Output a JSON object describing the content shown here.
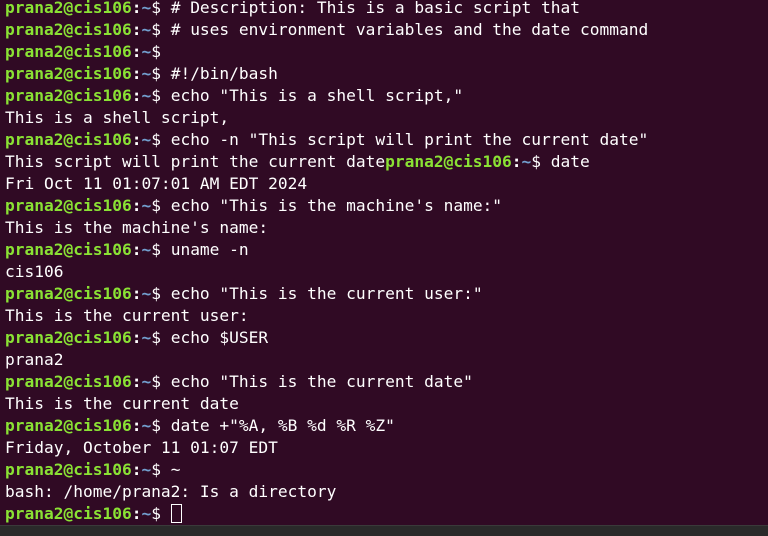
{
  "terminal": {
    "colors": {
      "background": "#300a24",
      "text": "#ffffff",
      "prompt_user": "#8ae234",
      "prompt_path": "#729fcf"
    },
    "prompt": {
      "user_host": "prana2@cis106",
      "colon": ":",
      "path": "~",
      "symbol": "$"
    },
    "lines": [
      {
        "type": "prompt",
        "cmd": " # Description: This is a basic script that"
      },
      {
        "type": "prompt",
        "cmd": " # uses environment variables and the date command"
      },
      {
        "type": "prompt",
        "cmd": ""
      },
      {
        "type": "prompt",
        "cmd": " #!/bin/bash"
      },
      {
        "type": "prompt",
        "cmd": " echo \"This is a shell script,\""
      },
      {
        "type": "output",
        "text": "This is a shell script,"
      },
      {
        "type": "prompt",
        "cmd": " echo -n \"This script will print the current date\""
      },
      {
        "type": "mixed",
        "text": "This script will print the current date",
        "cmd": " date"
      },
      {
        "type": "output",
        "text": "Fri Oct 11 01:07:01 AM EDT 2024"
      },
      {
        "type": "prompt",
        "cmd": " echo \"This is the machine's name:\""
      },
      {
        "type": "output",
        "text": "This is the machine's name:"
      },
      {
        "type": "prompt",
        "cmd": " uname -n"
      },
      {
        "type": "output",
        "text": "cis106"
      },
      {
        "type": "prompt",
        "cmd": " echo \"This is the current user:\""
      },
      {
        "type": "output",
        "text": "This is the current user:"
      },
      {
        "type": "prompt",
        "cmd": " echo $USER"
      },
      {
        "type": "output",
        "text": "prana2"
      },
      {
        "type": "prompt",
        "cmd": " echo \"This is the current date\""
      },
      {
        "type": "output",
        "text": "This is the current date"
      },
      {
        "type": "prompt",
        "cmd": " date +\"%A, %B %d %R %Z\""
      },
      {
        "type": "output",
        "text": "Friday, October 11 01:07 EDT"
      },
      {
        "type": "prompt",
        "cmd": " ~"
      },
      {
        "type": "output",
        "text": "bash: /home/prana2: Is a directory"
      },
      {
        "type": "current_prompt",
        "cmd": " "
      }
    ]
  }
}
